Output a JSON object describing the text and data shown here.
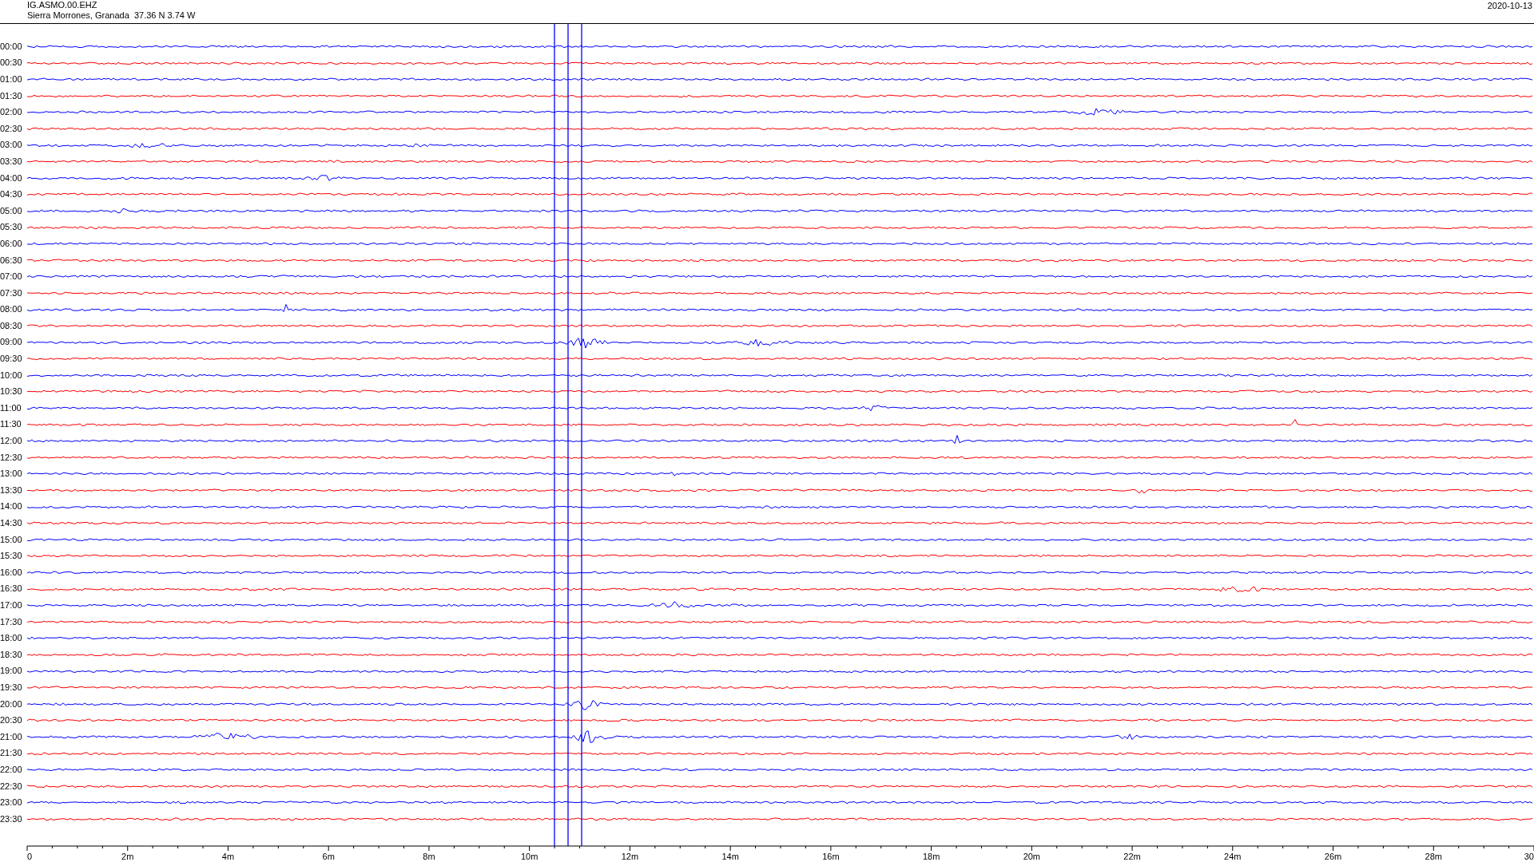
{
  "header": {
    "station": "IG.ASMO.00.EHZ",
    "location": "Sierra Morrones, Granada  37.36 N 3.74 W",
    "date": "2020-10-13"
  },
  "traces": [
    {
      "label": "00:00",
      "color": "#0000ff"
    },
    {
      "label": "00:30",
      "color": "#ff0000"
    },
    {
      "label": "01:00",
      "color": "#0000ff"
    },
    {
      "label": "01:30",
      "color": "#ff0000"
    },
    {
      "label": "02:00",
      "color": "#0000ff"
    },
    {
      "label": "02:30",
      "color": "#ff0000"
    },
    {
      "label": "03:00",
      "color": "#0000ff"
    },
    {
      "label": "03:30",
      "color": "#ff0000"
    },
    {
      "label": "04:00",
      "color": "#0000ff"
    },
    {
      "label": "04:30",
      "color": "#ff0000"
    },
    {
      "label": "05:00",
      "color": "#0000ff"
    },
    {
      "label": "05:30",
      "color": "#ff0000"
    },
    {
      "label": "06:00",
      "color": "#0000ff"
    },
    {
      "label": "06:30",
      "color": "#ff0000"
    },
    {
      "label": "07:00",
      "color": "#0000ff"
    },
    {
      "label": "07:30",
      "color": "#ff0000"
    },
    {
      "label": "08:00",
      "color": "#0000ff"
    },
    {
      "label": "08:30",
      "color": "#ff0000"
    },
    {
      "label": "09:00",
      "color": "#0000ff"
    },
    {
      "label": "09:30",
      "color": "#ff0000"
    },
    {
      "label": "10:00",
      "color": "#0000ff"
    },
    {
      "label": "10:30",
      "color": "#ff0000"
    },
    {
      "label": "11:00",
      "color": "#0000ff"
    },
    {
      "label": "11:30",
      "color": "#ff0000"
    },
    {
      "label": "12:00",
      "color": "#0000ff"
    },
    {
      "label": "12:30",
      "color": "#ff0000"
    },
    {
      "label": "13:00",
      "color": "#0000ff"
    },
    {
      "label": "13:30",
      "color": "#ff0000"
    },
    {
      "label": "14:00",
      "color": "#0000ff"
    },
    {
      "label": "14:30",
      "color": "#ff0000"
    },
    {
      "label": "15:00",
      "color": "#0000ff"
    },
    {
      "label": "15:30",
      "color": "#ff0000"
    },
    {
      "label": "16:00",
      "color": "#0000ff"
    },
    {
      "label": "16:30",
      "color": "#ff0000"
    },
    {
      "label": "17:00",
      "color": "#0000ff"
    },
    {
      "label": "17:30",
      "color": "#ff0000"
    },
    {
      "label": "18:00",
      "color": "#0000ff"
    },
    {
      "label": "18:30",
      "color": "#ff0000"
    },
    {
      "label": "19:00",
      "color": "#0000ff"
    },
    {
      "label": "19:30",
      "color": "#ff0000"
    },
    {
      "label": "20:00",
      "color": "#0000ff"
    },
    {
      "label": "20:30",
      "color": "#ff0000"
    },
    {
      "label": "21:00",
      "color": "#0000ff"
    },
    {
      "label": "21:30",
      "color": "#ff0000"
    },
    {
      "label": "22:00",
      "color": "#0000ff"
    },
    {
      "label": "22:30",
      "color": "#ff0000"
    },
    {
      "label": "23:00",
      "color": "#0000ff"
    },
    {
      "label": "23:30",
      "color": "#ff0000"
    }
  ],
  "x_axis": {
    "ticks": [
      "0",
      "2m",
      "4m",
      "6m",
      "8m",
      "10m",
      "12m",
      "14m",
      "16m",
      "18m",
      "20m",
      "22m",
      "24m",
      "26m",
      "28m",
      "30"
    ]
  }
}
